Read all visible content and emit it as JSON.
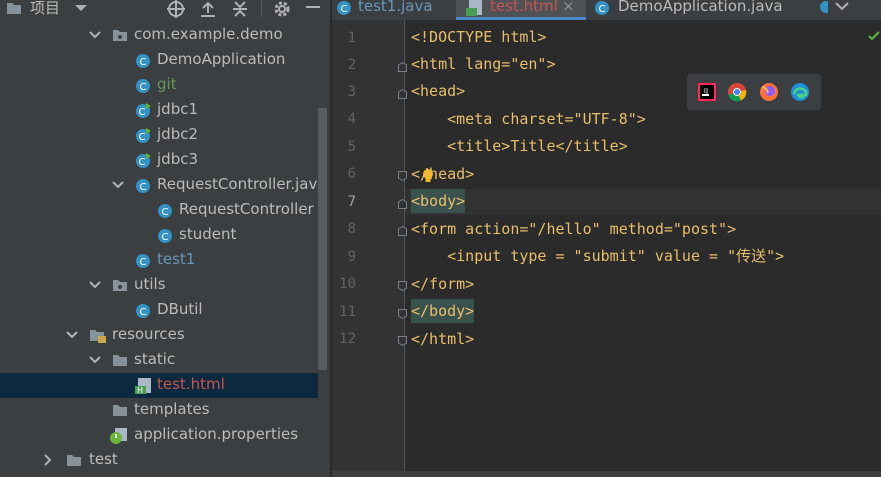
{
  "project_panel": {
    "title": "项目",
    "tree": [
      {
        "label": "com.example.demo",
        "kind": "package",
        "expanded": true
      },
      {
        "label": "DemoApplication",
        "kind": "class"
      },
      {
        "label": "git",
        "kind": "class-git"
      },
      {
        "label": "jdbc1",
        "kind": "class-run"
      },
      {
        "label": "jdbc2",
        "kind": "class-run"
      },
      {
        "label": "jdbc3",
        "kind": "class-run"
      },
      {
        "label": "RequestController.jav",
        "kind": "class",
        "expanded": true
      },
      {
        "label": "RequestController",
        "kind": "class"
      },
      {
        "label": "student",
        "kind": "class"
      },
      {
        "label": "test1",
        "kind": "class-modified"
      },
      {
        "label": "utils",
        "kind": "package",
        "expanded": true
      },
      {
        "label": "DButil",
        "kind": "class"
      },
      {
        "label": "resources",
        "kind": "resources-folder",
        "expanded": true
      },
      {
        "label": "static",
        "kind": "folder",
        "expanded": true
      },
      {
        "label": "test.html",
        "kind": "html-file",
        "selected": true
      },
      {
        "label": "templates",
        "kind": "folder"
      },
      {
        "label": "application.properties",
        "kind": "spring-properties"
      },
      {
        "label": "test",
        "kind": "folder",
        "expanded": false
      }
    ]
  },
  "editor": {
    "tabs": [
      {
        "label": "test1.java",
        "active": false
      },
      {
        "label": "test.html",
        "active": true,
        "close": "×"
      },
      {
        "label": "DemoApplication.java",
        "active": false
      }
    ],
    "current_line": 7,
    "lines": [
      {
        "num": "1",
        "text": "<!DOCTYPE html>"
      },
      {
        "num": "2",
        "text": "<html lang=\"en\">"
      },
      {
        "num": "3",
        "text": "<head>"
      },
      {
        "num": "4",
        "text": "    <meta charset=\"UTF-8\">"
      },
      {
        "num": "5",
        "text": "    <title>Title</title>"
      },
      {
        "num": "6",
        "text": "</head>"
      },
      {
        "num": "7",
        "text": "<body>"
      },
      {
        "num": "8",
        "text": "<form action=\"/hello\" method=\"post\">"
      },
      {
        "num": "9",
        "text": "    <input type = \"submit\" value = \"传送\">"
      },
      {
        "num": "10",
        "text": "</form>"
      },
      {
        "num": "11",
        "text": "</body>"
      },
      {
        "num": "12",
        "text": "</html>"
      }
    ],
    "browsers": [
      "intellij-icon",
      "chrome-icon",
      "firefox-icon",
      "edge-icon"
    ]
  },
  "colors": {
    "tag": "#e8bf6a",
    "attribute": "#bababa",
    "string": "#a5c25c",
    "selection": "#0d293e",
    "active_tab_text": "#c75450"
  }
}
